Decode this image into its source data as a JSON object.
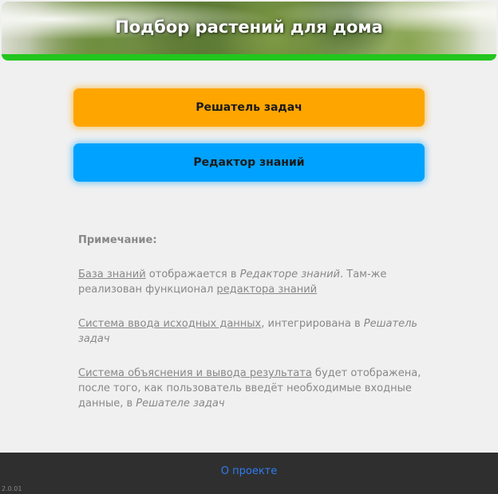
{
  "header": {
    "title": "Подбор растений для дома",
    "accent_color": "#22c61e"
  },
  "buttons": {
    "solver_label": "Решатель задач",
    "solver_color": "#ffa500",
    "editor_label": "Редактор знаний",
    "editor_color": "#00a2ff"
  },
  "notes": {
    "title": "Примечание:",
    "p1": {
      "link1": "База знаний",
      "text1": " отображается в ",
      "italic1": "Редакторе знаний",
      "text2": ". Там-же реализован функционал ",
      "link2": "редактора знаний"
    },
    "p2": {
      "link1": "Система ввода исходных данных",
      "text1": ", интегрирована в ",
      "italic1": "Решатель задач"
    },
    "p3": {
      "link1": "Система объяснения и вывода результата",
      "text1": " будет отображена, после того, как пользователь введёт необходимые входные данные, в ",
      "italic1": "Решателе задач"
    }
  },
  "footer": {
    "about_link": "О проекте",
    "link_color": "#2e7cf0"
  },
  "version": "2.0.01"
}
